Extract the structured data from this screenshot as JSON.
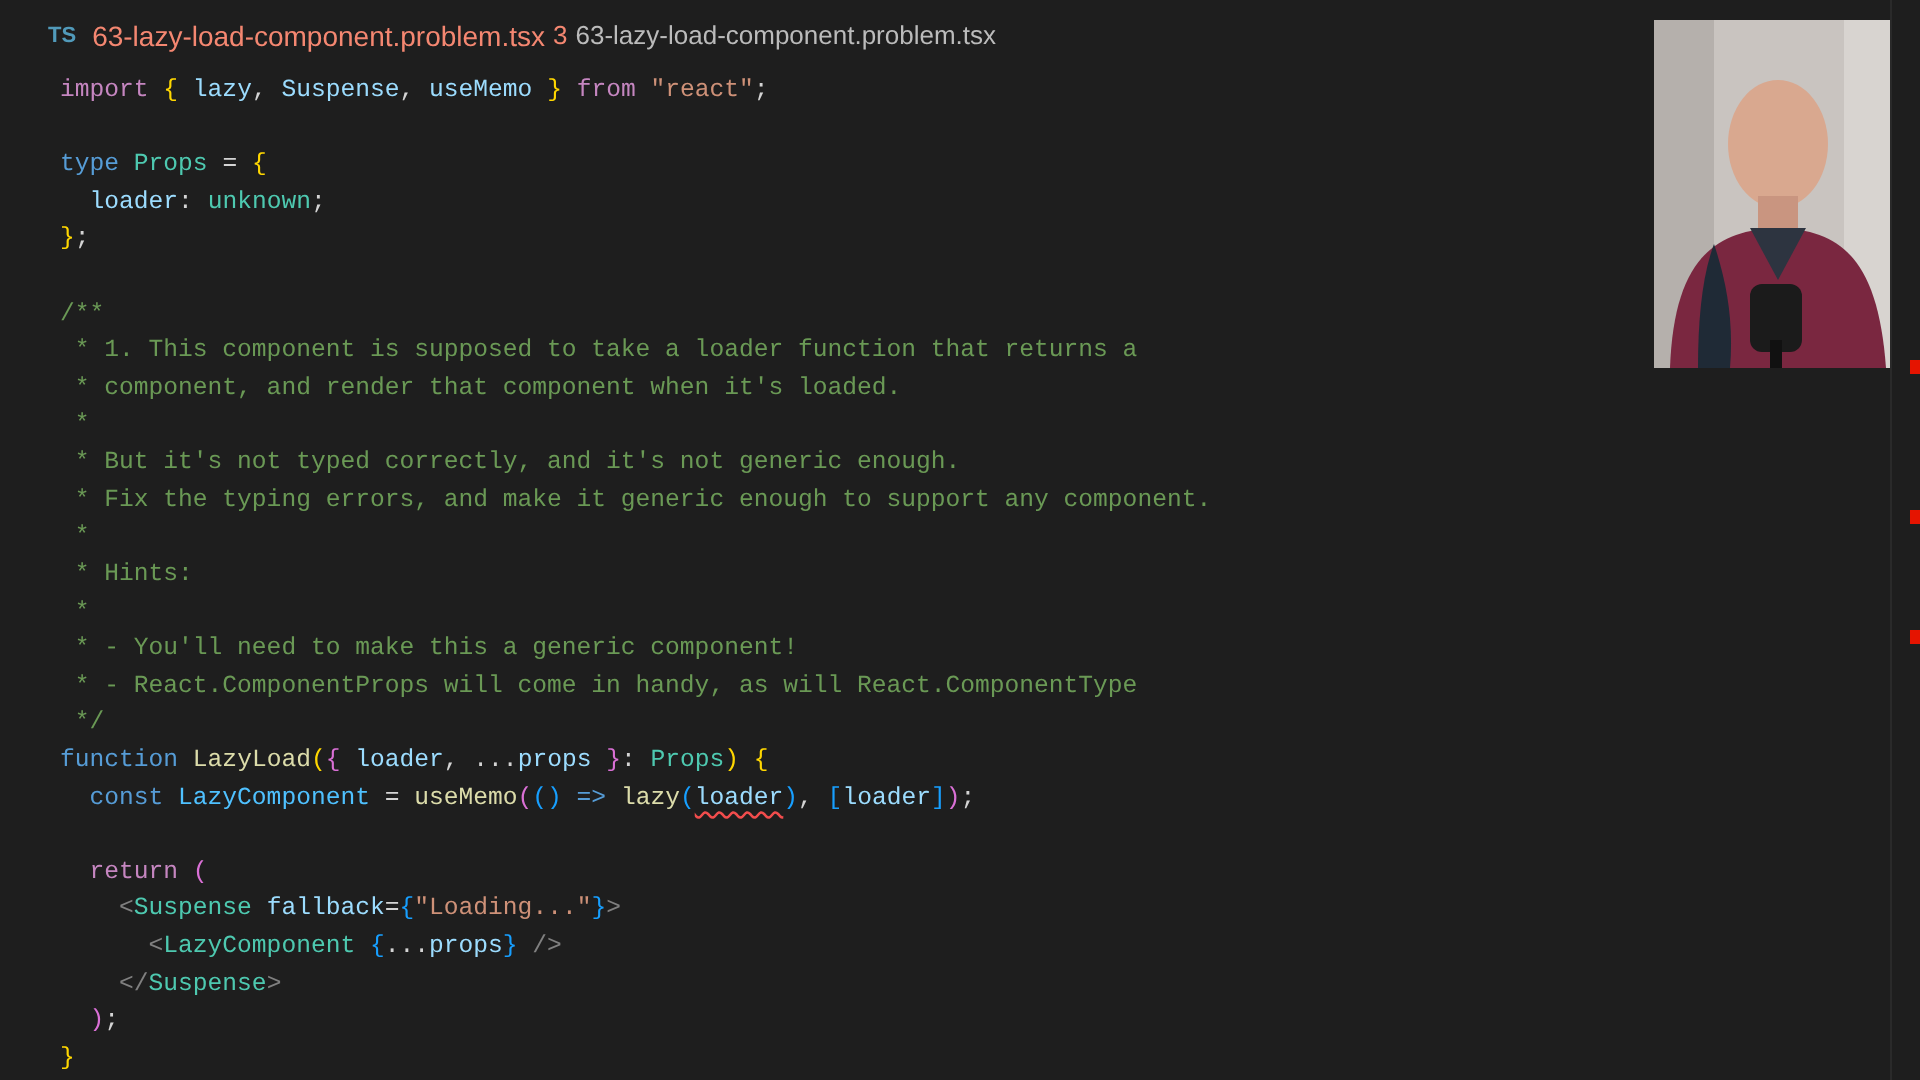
{
  "tab": {
    "language_badge": "TS",
    "filename": "63-lazy-load-component.problem.tsx",
    "problem_count": "3",
    "breadcrumb": "63-lazy-load-component.problem.tsx"
  },
  "editor": {
    "lines": [
      {
        "kind": "code",
        "tokens": [
          {
            "text": "import",
            "kind": "keyword"
          },
          {
            "text": " {",
            "kind": "bracket1"
          },
          {
            "text": " lazy",
            "kind": "variable"
          },
          {
            "text": ", ",
            "kind": "plain"
          },
          {
            "text": "Suspense",
            "kind": "variable"
          },
          {
            "text": ", ",
            "kind": "plain"
          },
          {
            "text": "useMemo",
            "kind": "variable"
          },
          {
            "text": " }",
            "kind": "bracket1"
          },
          {
            "text": " from ",
            "kind": "keyword"
          },
          {
            "text": "\"react\"",
            "kind": "string"
          },
          {
            "text": ";",
            "kind": "plain"
          }
        ]
      },
      {
        "kind": "blank"
      },
      {
        "kind": "code",
        "tokens": [
          {
            "text": "type",
            "kind": "storage"
          },
          {
            "text": " Props",
            "kind": "type"
          },
          {
            "text": " = ",
            "kind": "plain"
          },
          {
            "text": "{",
            "kind": "bracket1"
          }
        ]
      },
      {
        "kind": "code",
        "tokens": [
          {
            "text": "  loader",
            "kind": "variable"
          },
          {
            "text": ": ",
            "kind": "plain"
          },
          {
            "text": "unknown",
            "kind": "type"
          },
          {
            "text": ";",
            "kind": "plain"
          }
        ]
      },
      {
        "kind": "code",
        "tokens": [
          {
            "text": "}",
            "kind": "bracket1"
          },
          {
            "text": ";",
            "kind": "plain"
          }
        ]
      },
      {
        "kind": "blank"
      },
      {
        "kind": "code",
        "tokens": [
          {
            "text": "/**",
            "kind": "comment"
          }
        ]
      },
      {
        "kind": "code",
        "tokens": [
          {
            "text": " * 1. This component is supposed to take a loader function that returns a",
            "kind": "comment"
          }
        ]
      },
      {
        "kind": "code",
        "tokens": [
          {
            "text": " * component, and render that component when it's loaded.",
            "kind": "comment"
          }
        ]
      },
      {
        "kind": "code",
        "tokens": [
          {
            "text": " *",
            "kind": "comment"
          }
        ]
      },
      {
        "kind": "code",
        "tokens": [
          {
            "text": " * But it's not typed correctly, and it's not generic enough.",
            "kind": "comment"
          }
        ]
      },
      {
        "kind": "code",
        "tokens": [
          {
            "text": " * Fix the typing errors, and make it generic enough to support any component.",
            "kind": "comment"
          }
        ]
      },
      {
        "kind": "code",
        "tokens": [
          {
            "text": " *",
            "kind": "comment"
          }
        ]
      },
      {
        "kind": "code",
        "tokens": [
          {
            "text": " * Hints:",
            "kind": "comment"
          }
        ]
      },
      {
        "kind": "code",
        "tokens": [
          {
            "text": " *",
            "kind": "comment"
          }
        ]
      },
      {
        "kind": "code",
        "tokens": [
          {
            "text": " * - You'll need to make this a generic component!",
            "kind": "comment"
          }
        ]
      },
      {
        "kind": "code",
        "tokens": [
          {
            "text": " * - React.ComponentProps will come in handy, as will React.ComponentType",
            "kind": "comment"
          }
        ]
      },
      {
        "kind": "code",
        "tokens": [
          {
            "text": " */",
            "kind": "comment"
          }
        ]
      },
      {
        "kind": "code",
        "tokens": [
          {
            "text": "function",
            "kind": "storage"
          },
          {
            "text": " LazyLoad",
            "kind": "function"
          },
          {
            "text": "(",
            "kind": "bracket1"
          },
          {
            "text": "{",
            "kind": "bracket2"
          },
          {
            "text": " loader",
            "kind": "variable"
          },
          {
            "text": ", ...",
            "kind": "plain"
          },
          {
            "text": "props",
            "kind": "variable"
          },
          {
            "text": " }",
            "kind": "bracket2"
          },
          {
            "text": ": ",
            "kind": "plain"
          },
          {
            "text": "Props",
            "kind": "type"
          },
          {
            "text": ")",
            "kind": "bracket1"
          },
          {
            "text": " {",
            "kind": "bracket1"
          }
        ]
      },
      {
        "kind": "code",
        "tokens": [
          {
            "text": "  const",
            "kind": "storage"
          },
          {
            "text": " LazyComponent",
            "kind": "constant"
          },
          {
            "text": " = ",
            "kind": "plain"
          },
          {
            "text": "useMemo",
            "kind": "function"
          },
          {
            "text": "(",
            "kind": "bracket2"
          },
          {
            "text": "()",
            "kind": "bracket3"
          },
          {
            "text": " =>",
            "kind": "storage"
          },
          {
            "text": " lazy",
            "kind": "function"
          },
          {
            "text": "(",
            "kind": "bracket3"
          },
          {
            "text": "loader",
            "kind": "variable_error"
          },
          {
            "text": ")",
            "kind": "bracket3"
          },
          {
            "text": ", ",
            "kind": "plain"
          },
          {
            "text": "[",
            "kind": "bracket3"
          },
          {
            "text": "loader",
            "kind": "variable"
          },
          {
            "text": "]",
            "kind": "bracket3"
          },
          {
            "text": ")",
            "kind": "bracket2"
          },
          {
            "text": ";",
            "kind": "plain"
          }
        ]
      },
      {
        "kind": "blank"
      },
      {
        "kind": "code",
        "tokens": [
          {
            "text": "  return",
            "kind": "keyword"
          },
          {
            "text": " (",
            "kind": "bracket2"
          }
        ]
      },
      {
        "kind": "code",
        "tokens": [
          {
            "text": "    <",
            "kind": "tag_punct"
          },
          {
            "text": "Suspense",
            "kind": "type"
          },
          {
            "text": " fallback",
            "kind": "variable"
          },
          {
            "text": "=",
            "kind": "plain"
          },
          {
            "text": "{",
            "kind": "bracket3"
          },
          {
            "text": "\"Loading...\"",
            "kind": "string"
          },
          {
            "text": "}",
            "kind": "bracket3"
          },
          {
            "text": ">",
            "kind": "tag_punct"
          }
        ]
      },
      {
        "kind": "code",
        "tokens": [
          {
            "text": "      <",
            "kind": "tag_punct"
          },
          {
            "text": "LazyComponent",
            "kind": "type"
          },
          {
            "text": " {",
            "kind": "bracket3"
          },
          {
            "text": "...",
            "kind": "plain"
          },
          {
            "text": "props",
            "kind": "variable"
          },
          {
            "text": "}",
            "kind": "bracket3"
          },
          {
            "text": " />",
            "kind": "tag_punct"
          }
        ]
      },
      {
        "kind": "code",
        "tokens": [
          {
            "text": "    </",
            "kind": "tag_punct"
          },
          {
            "text": "Suspense",
            "kind": "type"
          },
          {
            "text": ">",
            "kind": "tag_punct"
          }
        ]
      },
      {
        "kind": "code",
        "tokens": [
          {
            "text": "  )",
            "kind": "bracket2"
          },
          {
            "text": ";",
            "kind": "plain"
          }
        ]
      },
      {
        "kind": "code",
        "tokens": [
          {
            "text": "}",
            "kind": "bracket1"
          }
        ]
      }
    ]
  }
}
